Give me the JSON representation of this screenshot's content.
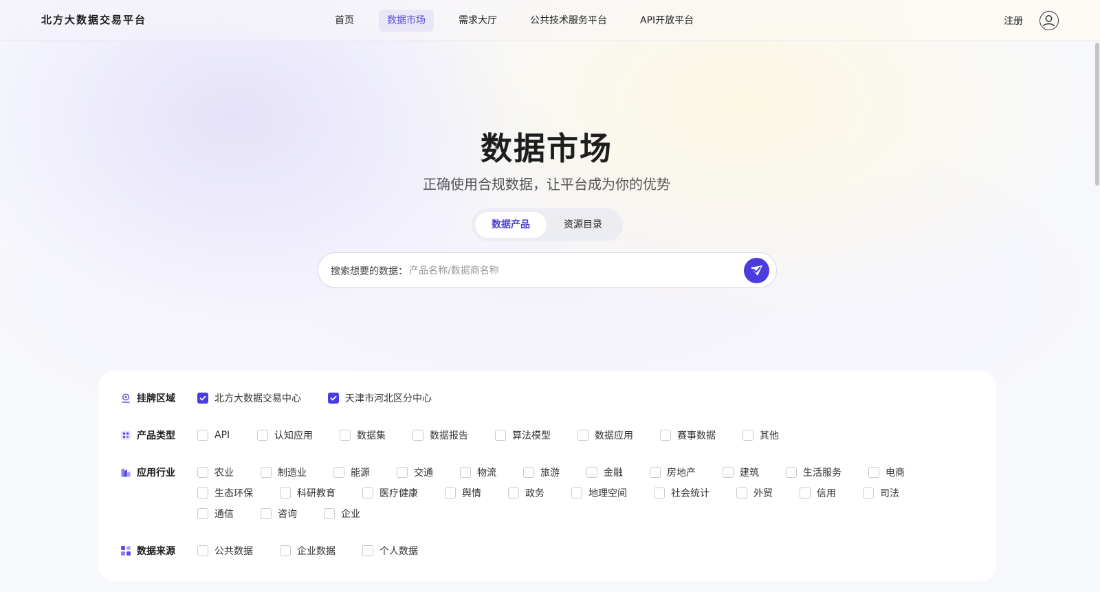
{
  "header": {
    "logo": "北方大数据交易平台",
    "nav": [
      "首页",
      "数据市场",
      "需求大厅",
      "公共技术服务平台",
      "API开放平台"
    ],
    "active_nav": "数据市场",
    "register": "注册"
  },
  "hero": {
    "title": "数据市场",
    "subtitle": "正确使用合规数据，让平台成为你的优势",
    "tabs": [
      "数据产品",
      "资源目录"
    ],
    "active_tab": "数据产品",
    "search_prefix": "搜索想要的数据：",
    "search_placeholder": "产品名称/数据商名称"
  },
  "filters": {
    "region": {
      "label": "挂牌区域",
      "options": [
        {
          "text": "北方大数据交易中心",
          "checked": true
        },
        {
          "text": "天津市河北区分中心",
          "checked": true
        }
      ]
    },
    "product_type": {
      "label": "产品类型",
      "options": [
        "API",
        "认知应用",
        "数据集",
        "数据报告",
        "算法模型",
        "数据应用",
        "赛事数据",
        "其他"
      ]
    },
    "industry": {
      "label": "应用行业",
      "rows": [
        [
          "农业",
          "制造业",
          "能源",
          "交通",
          "物流",
          "旅游",
          "金融",
          "房地产",
          "建筑",
          "生活服务",
          "电商"
        ],
        [
          "生态环保",
          "科研教育",
          "医疗健康",
          "舆情",
          "政务",
          "地理空间",
          "社会统计",
          "外贸",
          "信用",
          "司法"
        ],
        [
          "通信",
          "咨询",
          "企业"
        ]
      ]
    },
    "source": {
      "label": "数据来源",
      "options": [
        "公共数据",
        "企业数据",
        "个人数据"
      ]
    }
  },
  "colors": {
    "accent": "#4b3ce0",
    "active_nav_bg": "#e8e7f5"
  },
  "icons": {
    "region": "location-pin-icon",
    "product_type": "grid-icon",
    "industry": "industry-icon",
    "source": "blocks-icon",
    "search": "send-icon",
    "user": "user-icon"
  }
}
